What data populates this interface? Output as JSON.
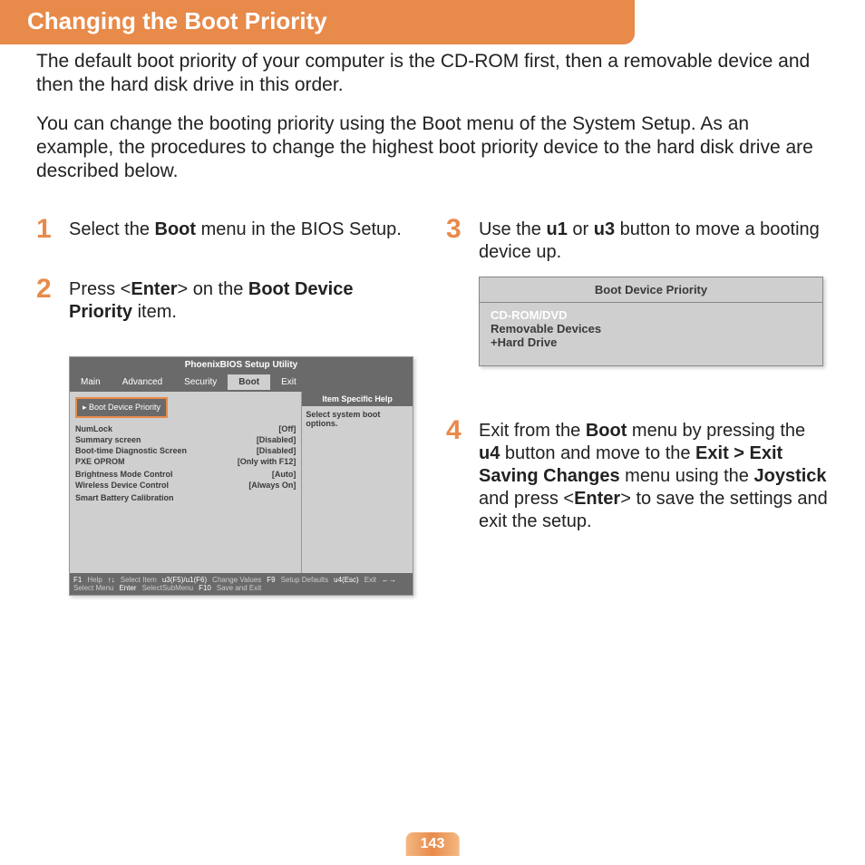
{
  "header": "Changing the Boot Priority",
  "intro1": "The default boot priority of your computer is the CD-ROM first, then a removable device and then the hard disk drive in this order.",
  "intro2": "You can change the booting priority using the Boot menu of the System Setup. As an example, the procedures to change the highest boot priority device to the hard disk drive are described below.",
  "steps": {
    "s1a": "Select the ",
    "s1b": "Boot",
    "s1c": " menu in the BIOS Setup.",
    "s2a": "Press <",
    "s2b": "Enter",
    "s2c": "> on the ",
    "s2d": "Boot Device Priority",
    "s2e": " item.",
    "s3a": "Use the ",
    "s3b": "u1",
    "s3c": " or ",
    "s3d": "u3",
    "s3e": " button to move a booting device up.",
    "s4a": "Exit from the ",
    "s4b": "Boot",
    "s4c": " menu by pressing the ",
    "s4d": "u4",
    "s4e": " button and move to the ",
    "s4f": "Exit > Exit Saving Changes",
    "s4g": " menu using the ",
    "s4h": "Joystick",
    "s4i": " and press <",
    "s4j": "Enter",
    "s4k": "> to save the settings and exit the setup."
  },
  "bios": {
    "title": "PhoenixBIOS Setup Utility",
    "tabs": [
      "Main",
      "Advanced",
      "Security",
      "Boot",
      "Exit"
    ],
    "highlight": "▸ Boot Device Priority",
    "rows": [
      {
        "label": "NumLock",
        "value": "[Off]"
      },
      {
        "label": "Summary screen",
        "value": "[Disabled]"
      },
      {
        "label": "Boot-time Diagnostic Screen",
        "value": "[Disabled]"
      },
      {
        "label": "PXE OPROM",
        "value": "[Only with F12]"
      },
      {
        "label": "",
        "value": ""
      },
      {
        "label": "Brightness Mode Control",
        "value": "[Auto]"
      },
      {
        "label": "Wireless Device Control",
        "value": "[Always On]"
      },
      {
        "label": "",
        "value": ""
      },
      {
        "label": "Smart Battery Calibration",
        "value": ""
      }
    ],
    "help_head": "Item Specific Help",
    "help_body": "Select system boot options.",
    "footer": {
      "f1": "F1",
      "f1l": "Help",
      "ud": "↑↓",
      "udl": "Select Item",
      "f5": "u3(F5)/u1(F6)",
      "f5l": "Change Values",
      "f9": "F9",
      "f9l": "Setup Defaults",
      "esc": "u4(Esc)",
      "escl": "Exit",
      "lr": "←→",
      "lrl": "Select Menu",
      "ent": "Enter",
      "entl": "SelectSubMenu",
      "f10": "F10",
      "f10l": "Save and Exit"
    }
  },
  "priority": {
    "title": "Boot Device Priority",
    "items": [
      "CD-ROM/DVD",
      "Removable Devices",
      "+Hard Drive"
    ]
  },
  "page_number": "143"
}
